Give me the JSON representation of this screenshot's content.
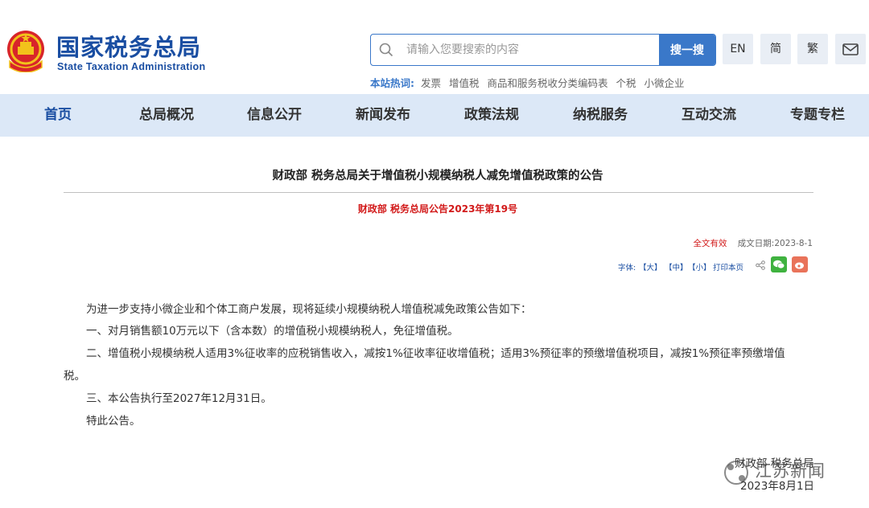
{
  "header": {
    "logo_title": "国家税务总局",
    "logo_subtitle": "State Taxation Administration",
    "search_placeholder": "请输入您要搜索的内容",
    "search_button": "搜一搜",
    "lang_en": "EN",
    "lang_simplified": "简",
    "lang_traditional": "繁",
    "hot_label": "本站热词:",
    "hot_words": [
      "发票",
      "增值税",
      "商品和服务税收分类编码表",
      "个税",
      "小微企业"
    ]
  },
  "nav": {
    "items": [
      "首页",
      "总局概况",
      "信息公开",
      "新闻发布",
      "政策法规",
      "纳税服务",
      "互动交流",
      "专题专栏"
    ]
  },
  "article": {
    "title": "财政部 税务总局关于增值税小规模纳税人减免增值税政策的公告",
    "doc_number": "财政部 税务总局公告2023年第19号",
    "validity": "全文有效",
    "date_label": "成文日期:2023-8-1",
    "font_label": "字体:",
    "font_large": "【大】",
    "font_medium": "【中】",
    "font_small": "【小】",
    "print_label": "打印本页",
    "paragraphs": [
      "为进一步支持小微企业和个体工商户发展，现将延续小规模纳税人增值税减免政策公告如下：",
      "一、对月销售额10万元以下（含本数）的增值税小规模纳税人，免征增值税。",
      "二、增值税小规模纳税人适用3%征收率的应税销售收入，减按1%征收率征收增值税；适用3%预征率的预缴增值税项目，减按1%预征率预缴增值",
      "税。",
      "三、本公告执行至2027年12月31日。",
      "特此公告。"
    ],
    "signer": "财政部 税务总局",
    "sign_date": "2023年8月1日"
  },
  "watermark": "江苏新闻",
  "colors": {
    "brand_blue": "#1a4ea2",
    "search_blue": "#3a78c9",
    "nav_bg": "#dce8f7",
    "accent_red": "#d21a1a"
  }
}
